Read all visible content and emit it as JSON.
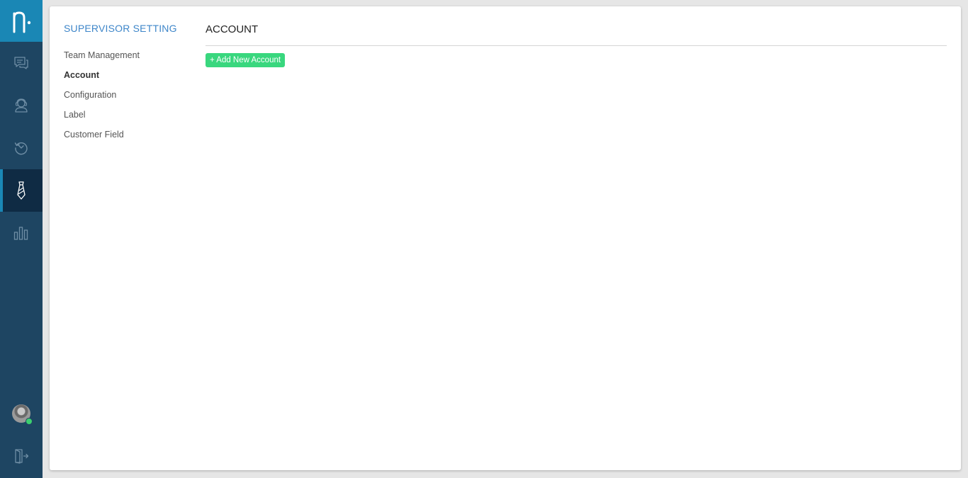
{
  "rail": {
    "logo_icon": "brand-logo-icon",
    "items": [
      {
        "icon": "chat-icon",
        "active": false
      },
      {
        "icon": "agent-icon",
        "active": false
      },
      {
        "icon": "history-icon",
        "active": false
      },
      {
        "icon": "tie-icon",
        "active": true
      },
      {
        "icon": "bar-chart-icon",
        "active": false
      }
    ],
    "user_status": "online",
    "logout_icon": "logout-icon"
  },
  "settings": {
    "title": "SUPERVISOR SETTING",
    "nav": [
      {
        "label": "Team Management",
        "active": false
      },
      {
        "label": "Account",
        "active": true
      },
      {
        "label": "Configuration",
        "active": false
      },
      {
        "label": "Label",
        "active": false
      },
      {
        "label": "Customer Field",
        "active": false
      }
    ]
  },
  "main": {
    "title": "ACCOUNT",
    "add_button_label": "+ Add New Account"
  },
  "colors": {
    "rail": "#1e4562",
    "rail_active": "#0f2b44",
    "brand": "#1a87b5",
    "accent_text": "#3e86c9",
    "add_button": "#39d77e",
    "status_online": "#3ccf6f"
  }
}
